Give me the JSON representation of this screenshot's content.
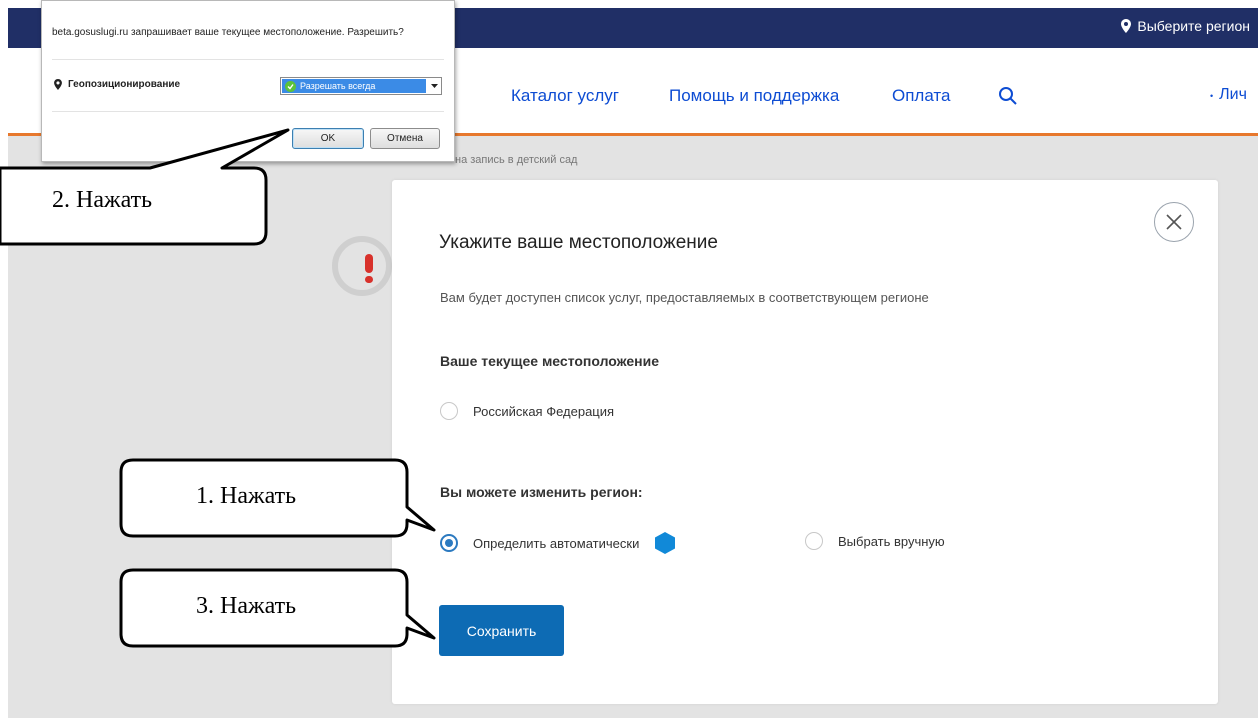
{
  "header": {
    "region_link": "Выберите регион",
    "nav": [
      "Каталог услуг",
      "Помощь и поддержка",
      "Оплата"
    ],
    "account_partial": "Лич"
  },
  "breadcrumb": "на запись в детский сад",
  "modal": {
    "title": "Укажите ваше местоположение",
    "subtitle": "Вам будет доступен список услуг, предоставляемых в соответствующем регионе",
    "current_location_label": "Ваше текущее местоположение",
    "current_location_option": "Российская Федерация",
    "change_region_label": "Вы можете изменить регион:",
    "option_auto": "Определить автоматически",
    "option_manual": "Выбрать вручную",
    "selected_option": "Определить автоматически",
    "save_button": "Сохранить"
  },
  "geo_dialog": {
    "question": "beta.gosuslugi.ru запрашивает ваше текущее местоположение. Разрешить?",
    "permission_label": "Геопозиционирование",
    "select_value": "Разрешать всегда",
    "ok_button": "OK",
    "cancel_button": "Отмена"
  },
  "callouts": {
    "step1": "1. Нажать",
    "step2": "2. Нажать",
    "step3": "3. Нажать"
  },
  "colors": {
    "topbar": "#202f66",
    "nav_link": "#0d4cd3",
    "accent_line": "#e7782d",
    "primary_button": "#0d6bb4",
    "alert": "#d8312b"
  }
}
